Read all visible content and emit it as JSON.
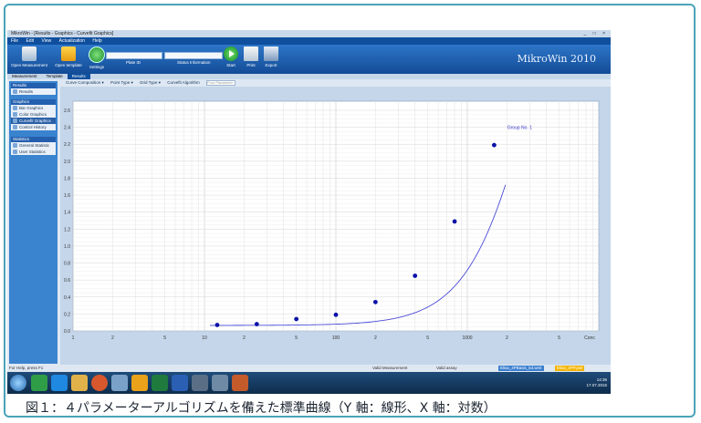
{
  "caption": "図１：４パラメーターアルゴリズムを備えた標準曲線（Y 軸：線形、X 軸：対数）",
  "window": {
    "title": "MikroWin - [Results - Graphics - Curvefit Graphics]",
    "controls": "_ □ ×"
  },
  "menu": [
    "File",
    "Edit",
    "View",
    "Actualization",
    "Help"
  ],
  "ribbon": {
    "open_measurement": "Open Measurement",
    "open_template": "Open template",
    "settings": "Settings",
    "plate_label": "Plate ID",
    "status_label": "Status Information",
    "start": "Start",
    "print": "Print",
    "export": "Export",
    "brand": "MikroWin 2010"
  },
  "tabs": [
    "Measurement",
    "Template",
    "Results"
  ],
  "sidebar": {
    "results_head": "Results",
    "results_items": [
      "Results"
    ],
    "graphics_head": "Graphics",
    "graphics_items": [
      "Bar Graphics",
      "Color Graphics",
      "Curvefit Graphics",
      "Control History"
    ],
    "statistics_head": "Statistics",
    "statistics_items": [
      "General Statistic",
      "User Statistics"
    ]
  },
  "toolbar": {
    "curve": "Curve Composition ▾",
    "point": "Point Type ▾",
    "grid": "Grid Type ▾",
    "algorithm": "Curvefit Algorithm",
    "field": "Four Parameter"
  },
  "statusbar": {
    "left": "For Help, press F1",
    "valid_measurement": "Valid Measurement",
    "valid_assay": "Valid assay",
    "file1": "Elisa_4PBasis_kd.wmt",
    "file2": "Elisa_4PP.pwl"
  },
  "clock": {
    "time": "14:36",
    "date": "17.07.2015"
  },
  "colors": {
    "curve": "#4a4ad8",
    "point": "#0a12a8",
    "ribbon": "#1b5fb0"
  },
  "chart_data": {
    "type": "scatter",
    "xscale": "log",
    "xlim": [
      1,
      10000
    ],
    "ylim": [
      0,
      2.6
    ],
    "xlabel": "Conc",
    "ylabel": "",
    "x_ticks": [
      "1",
      "2",
      "5",
      "10",
      "2",
      "5",
      "100",
      "2",
      "5",
      "1000",
      "2",
      "5",
      "Conc"
    ],
    "y_ticks": [
      "0.0",
      "0.2",
      "0.4",
      "0.6",
      "0.8",
      "1.0",
      "1.2",
      "1.4",
      "1.6",
      "1.8",
      "2.0",
      "2.2",
      "2.4",
      "2.6"
    ],
    "grid": true,
    "series": [
      {
        "name": "Group No. 1",
        "x": [
          12.5,
          25,
          50,
          100,
          200,
          400,
          800,
          1600
        ],
        "y": [
          0.07,
          0.08,
          0.14,
          0.19,
          0.34,
          0.65,
          1.29,
          2.19
        ]
      }
    ]
  }
}
